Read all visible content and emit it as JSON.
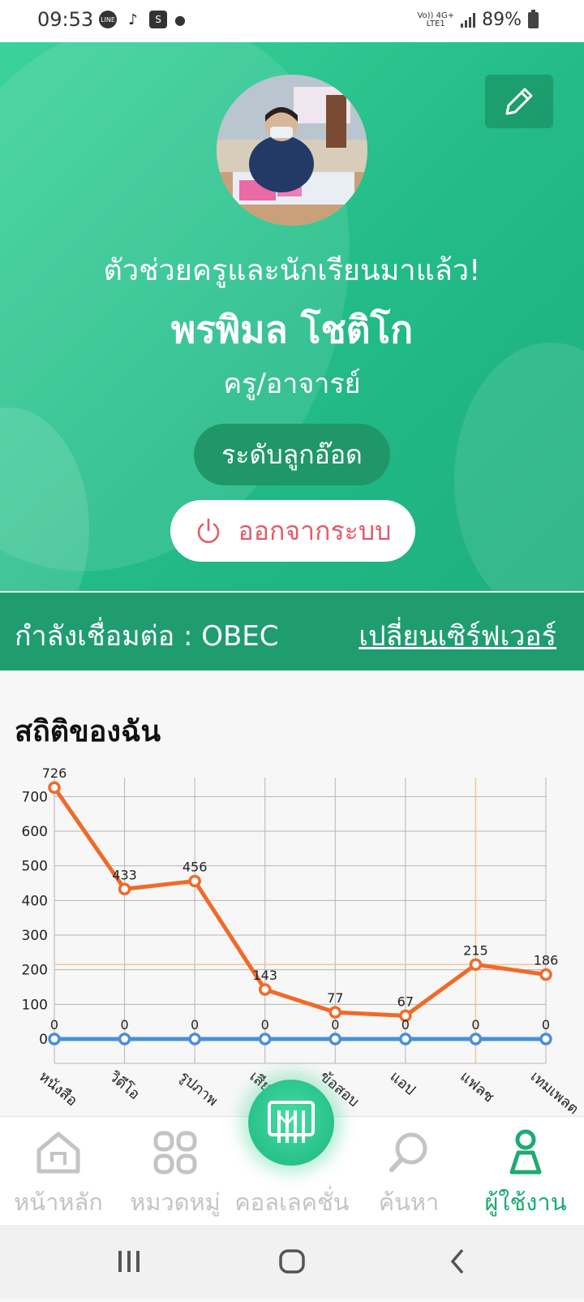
{
  "status_bar": {
    "time": "09:53",
    "network_top": "Vo)) 4G+",
    "network_bottom": "LTE1",
    "battery": "89%"
  },
  "profile": {
    "greeting": "ตัวช่วยครูและนักเรียนมาแล้ว!",
    "name": "พรพิมล โชติโก",
    "role": "ครู/อาจารย์",
    "level": "ระดับลูกอ๊อด",
    "logout_label": "ออกจากระบบ"
  },
  "server": {
    "connected_label": "กำลังเชื่อมต่อ : OBEC",
    "change_label": "เปลี่ยนเซิร์ฟเวอร์"
  },
  "stats": {
    "title": "สถิติของฉัน"
  },
  "chart_data": {
    "type": "line",
    "categories": [
      "หนังสือ",
      "วิดีโอ",
      "รูปภาพ",
      "เสียง",
      "ข้อสอบ",
      "แอป",
      "แฟลช",
      "เทมเพลต"
    ],
    "series": [
      {
        "values": [
          726,
          433,
          456,
          143,
          77,
          67,
          215,
          186
        ],
        "color": "#f06a2a"
      },
      {
        "values": [
          0,
          0,
          0,
          0,
          0,
          0,
          0,
          0
        ],
        "color": "#4a8fd8"
      }
    ],
    "y_ticks": [
      0,
      100,
      200,
      300,
      400,
      500,
      600,
      700
    ],
    "ylim": [
      0,
      750
    ],
    "grid": true,
    "highlight_index": 6,
    "highlight_color": "#f5c690"
  },
  "nav": {
    "items": [
      {
        "label": "หน้าหลัก",
        "icon": "home-icon"
      },
      {
        "label": "หมวดหมู่",
        "icon": "category-icon"
      },
      {
        "label": "คอลเลคชั่น",
        "icon": "collection-icon"
      },
      {
        "label": "ค้นหา",
        "icon": "search-icon"
      },
      {
        "label": "ผู้ใช้งาน",
        "icon": "user-icon"
      }
    ],
    "active_index": 4
  },
  "colors": {
    "primary": "#22bb87",
    "accent_red": "#e35b6b",
    "active_nav": "#1daa73"
  }
}
